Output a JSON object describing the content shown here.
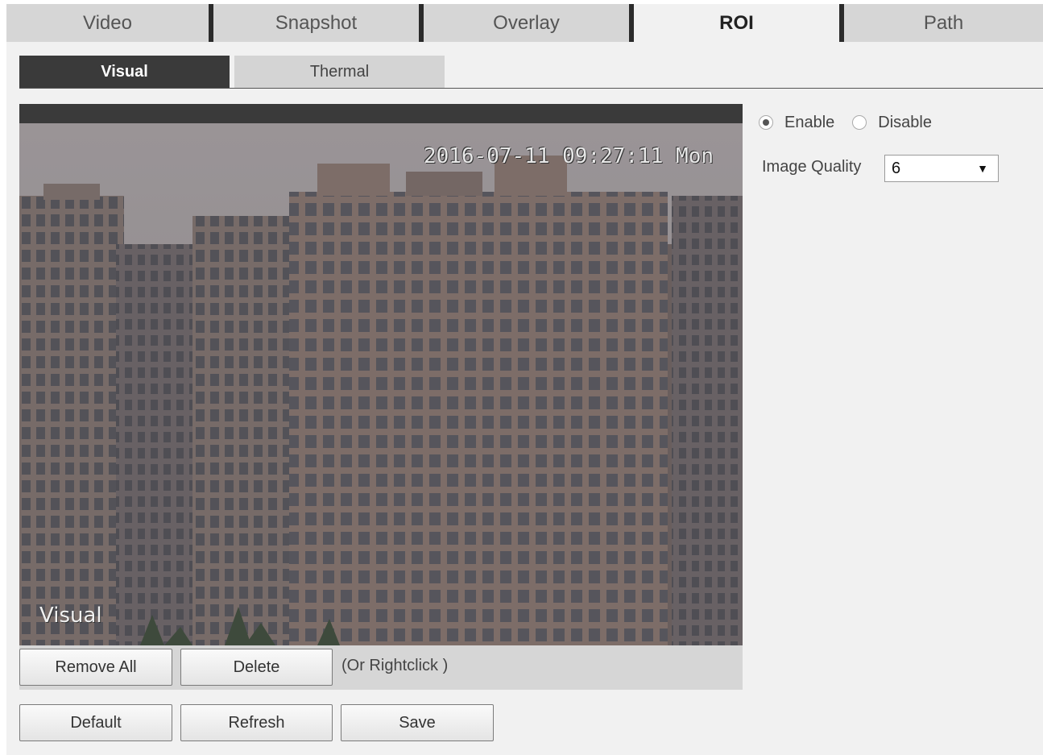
{
  "tabs": [
    {
      "label": "Video",
      "active": false
    },
    {
      "label": "Snapshot",
      "active": false
    },
    {
      "label": "Overlay",
      "active": false
    },
    {
      "label": "ROI",
      "active": true
    },
    {
      "label": "Path",
      "active": false
    }
  ],
  "subtabs": [
    {
      "label": "Visual",
      "active": true
    },
    {
      "label": "Thermal",
      "active": false
    }
  ],
  "video": {
    "timestamp": "2016-07-11 09:27:11 Mon",
    "channel_label": "Visual"
  },
  "toolbar": {
    "remove_all_label": "Remove All",
    "delete_label": "Delete",
    "hint": "(Or Rightclick )"
  },
  "actions": {
    "default_label": "Default",
    "refresh_label": "Refresh",
    "save_label": "Save"
  },
  "roi": {
    "enable_label": "Enable",
    "disable_label": "Disable",
    "enabled": true,
    "image_quality_label": "Image Quality",
    "image_quality_value": "6"
  },
  "colors": {
    "tab_bg": "#d6d6d6",
    "tab_separator": "#2b2b2b",
    "subtab_active": "#3a3a3a",
    "content_bg": "#f1f1f1"
  },
  "icons": {
    "dropdown": "chevron-down-icon",
    "radio_selected": "radio-checked-icon",
    "radio_unselected": "radio-unchecked-icon"
  }
}
